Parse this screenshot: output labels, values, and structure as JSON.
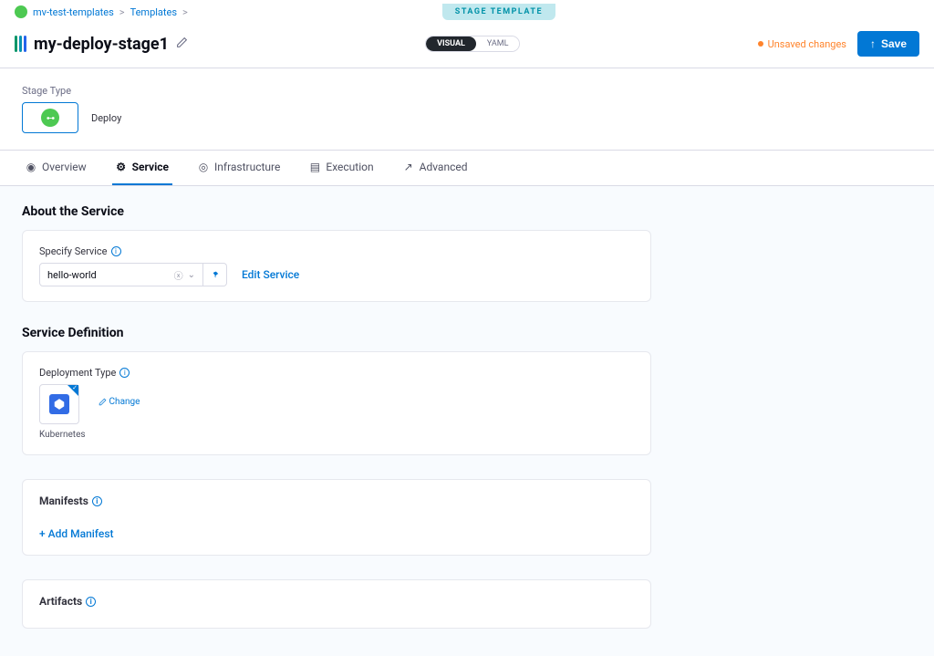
{
  "breadcrumb": {
    "project": "mv-test-templates",
    "section": "Templates",
    "sep": ">"
  },
  "stage_badge": "STAGE TEMPLATE",
  "header": {
    "title": "my-deploy-stage1",
    "toggle": {
      "visual": "VISUAL",
      "yaml": "YAML"
    },
    "unsaved": "Unsaved changes",
    "save": "Save"
  },
  "stage": {
    "label": "Stage Type",
    "name": "Deploy"
  },
  "tabs": {
    "overview": "Overview",
    "service": "Service",
    "infrastructure": "Infrastructure",
    "execution": "Execution",
    "advanced": "Advanced"
  },
  "about": {
    "title": "About the Service",
    "field_label": "Specify Service",
    "value": "hello-world",
    "edit": "Edit Service"
  },
  "service_def": {
    "title": "Service Definition",
    "deploy_label": "Deployment Type",
    "tile_label": "Kubernetes",
    "change": "Change"
  },
  "manifests": {
    "title": "Manifests",
    "add": "+ Add Manifest"
  },
  "artifacts": {
    "title": "Artifacts"
  }
}
